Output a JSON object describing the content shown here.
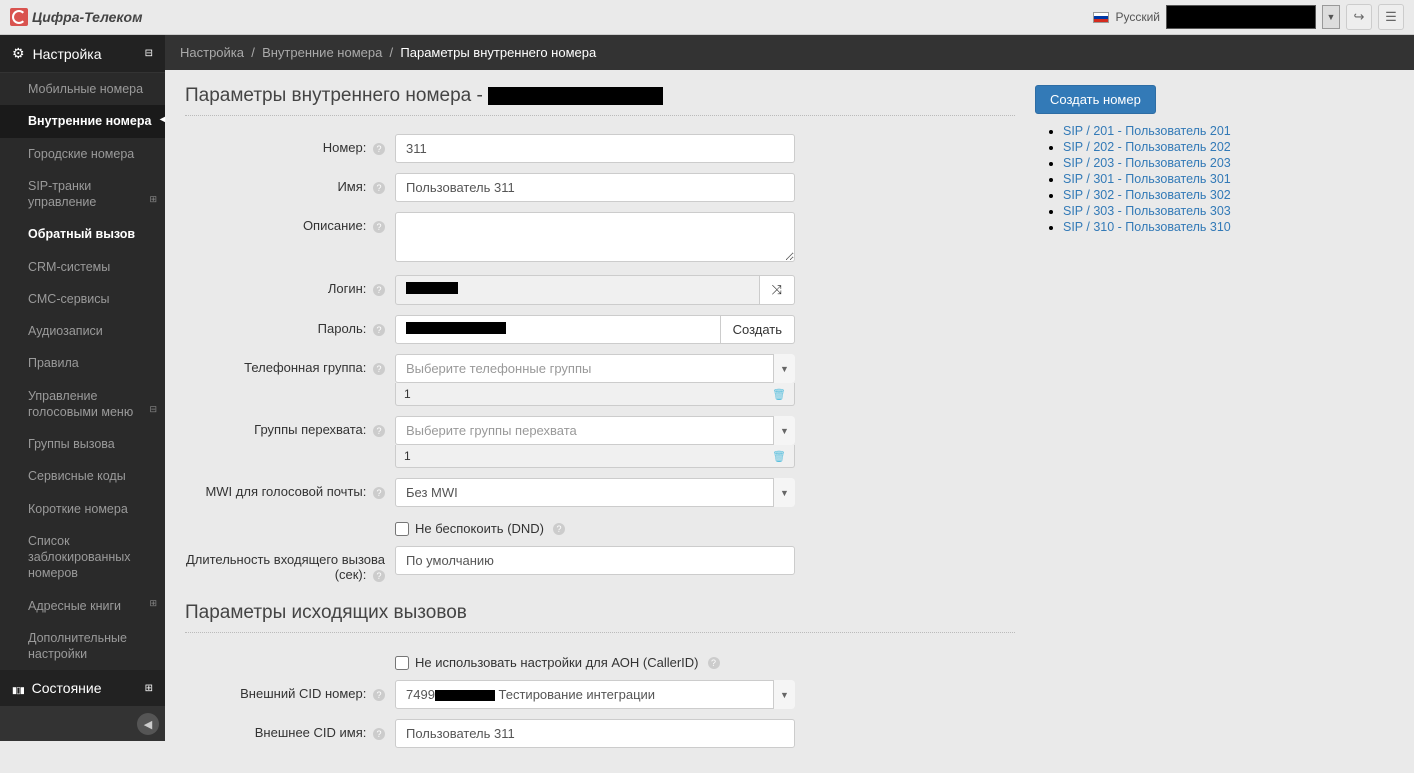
{
  "header": {
    "brand": "Цифра-Телеком",
    "language": "Русский"
  },
  "breadcrumb": {
    "l1": "Настройка",
    "l2": "Внутренние номера",
    "l3": "Параметры внутреннего номера"
  },
  "sidebar": {
    "section1": {
      "title": "Настройка"
    },
    "items": [
      "Мобильные номера",
      "Внутренние номера",
      "Городские номера",
      "SIP-транки управление",
      "Обратный вызов",
      "CRM-системы",
      "СМС-сервисы",
      "Аудиозаписи",
      "Правила",
      "Управление голосовыми меню",
      "Группы вызова",
      "Сервисные коды",
      "Короткие номера",
      "Список заблокированных номеров",
      "Адресные книги",
      "Дополнительные настройки"
    ],
    "section2": {
      "title": "Состояние"
    }
  },
  "page": {
    "title": "Параметры внутреннего номера -",
    "labels": {
      "number": "Номер:",
      "name": "Имя:",
      "description": "Описание:",
      "login": "Логин:",
      "password": "Пароль:",
      "phone_group": "Телефонная группа:",
      "pickup_group": "Группы перехвата:",
      "mwi": "MWI для голосовой почты:",
      "dnd": "Не беспокоить (DND)",
      "duration": "Длительность входящего вызова (сек):",
      "outgoing_section": "Параметры исходящих вызовов",
      "no_callerid": "Не использовать настройки для АОН (CallerID)",
      "ext_cid_num": "Внешний CID номер:",
      "ext_cid_name": "Внешнее CID имя:"
    },
    "values": {
      "number": "311",
      "name": "Пользователь 311",
      "description": "",
      "phone_group_placeholder": "Выберите телефонные группы",
      "phone_group_tag": "1",
      "pickup_placeholder": "Выберите группы перехвата",
      "pickup_tag": "1",
      "mwi": "Без MWI",
      "duration": "По умолчанию",
      "ext_cid_num_prefix": "7499",
      "ext_cid_num_suffix": " Тестирование интеграции",
      "ext_cid_name": "Пользователь 311",
      "gen_password_btn": "Создать"
    }
  },
  "right": {
    "create_btn": "Создать номер",
    "sip": [
      "SIP / 201 - Пользователь 201",
      "SIP / 202 - Пользователь 202",
      "SIP / 203 - Пользователь 203",
      "SIP / 301 - Пользователь 301",
      "SIP / 302 - Пользователь 302",
      "SIP / 303 - Пользователь 303",
      "SIP / 310 - Пользователь 310"
    ]
  }
}
